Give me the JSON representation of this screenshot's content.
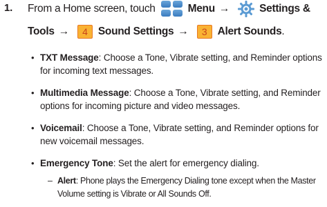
{
  "step": {
    "number": "1.",
    "intro": "From a Home screen, touch",
    "menu_label": "Menu",
    "arrow": "→",
    "settings_label": "Settings &",
    "tools_label": "Tools",
    "key1": "4",
    "sound_settings_label": "Sound Settings",
    "key2": "3",
    "alert_sounds_label": "Alert Sounds",
    "period": "."
  },
  "bullets": [
    {
      "term": "TXT Message",
      "text": ": Choose a Tone, Vibrate setting, and Reminder options for incoming text messages."
    },
    {
      "term": "Multimedia Message",
      "text": ": Choose a Tone, Vibrate setting, and Reminder options for incoming picture and video messages."
    },
    {
      "term": "Voicemail",
      "text": ": Choose a Tone, Vibrate setting, and Reminder options for new voicemail messages."
    },
    {
      "term": "Emergency Tone",
      "text": ": Set the alert for emergency dialing."
    }
  ],
  "sub_bullet": {
    "term": "Alert",
    "text": ": Phone plays the Emergency Dialing tone except when the Master Volume setting is Vibrate or All Sounds Off."
  },
  "colors": {
    "menu_icon": "#3a7bbf",
    "key_fill": "#f9b233",
    "key_border": "#e87722",
    "key_text": "#c8451a"
  },
  "icons": [
    "menu-grid-icon",
    "settings-gear-icon"
  ]
}
